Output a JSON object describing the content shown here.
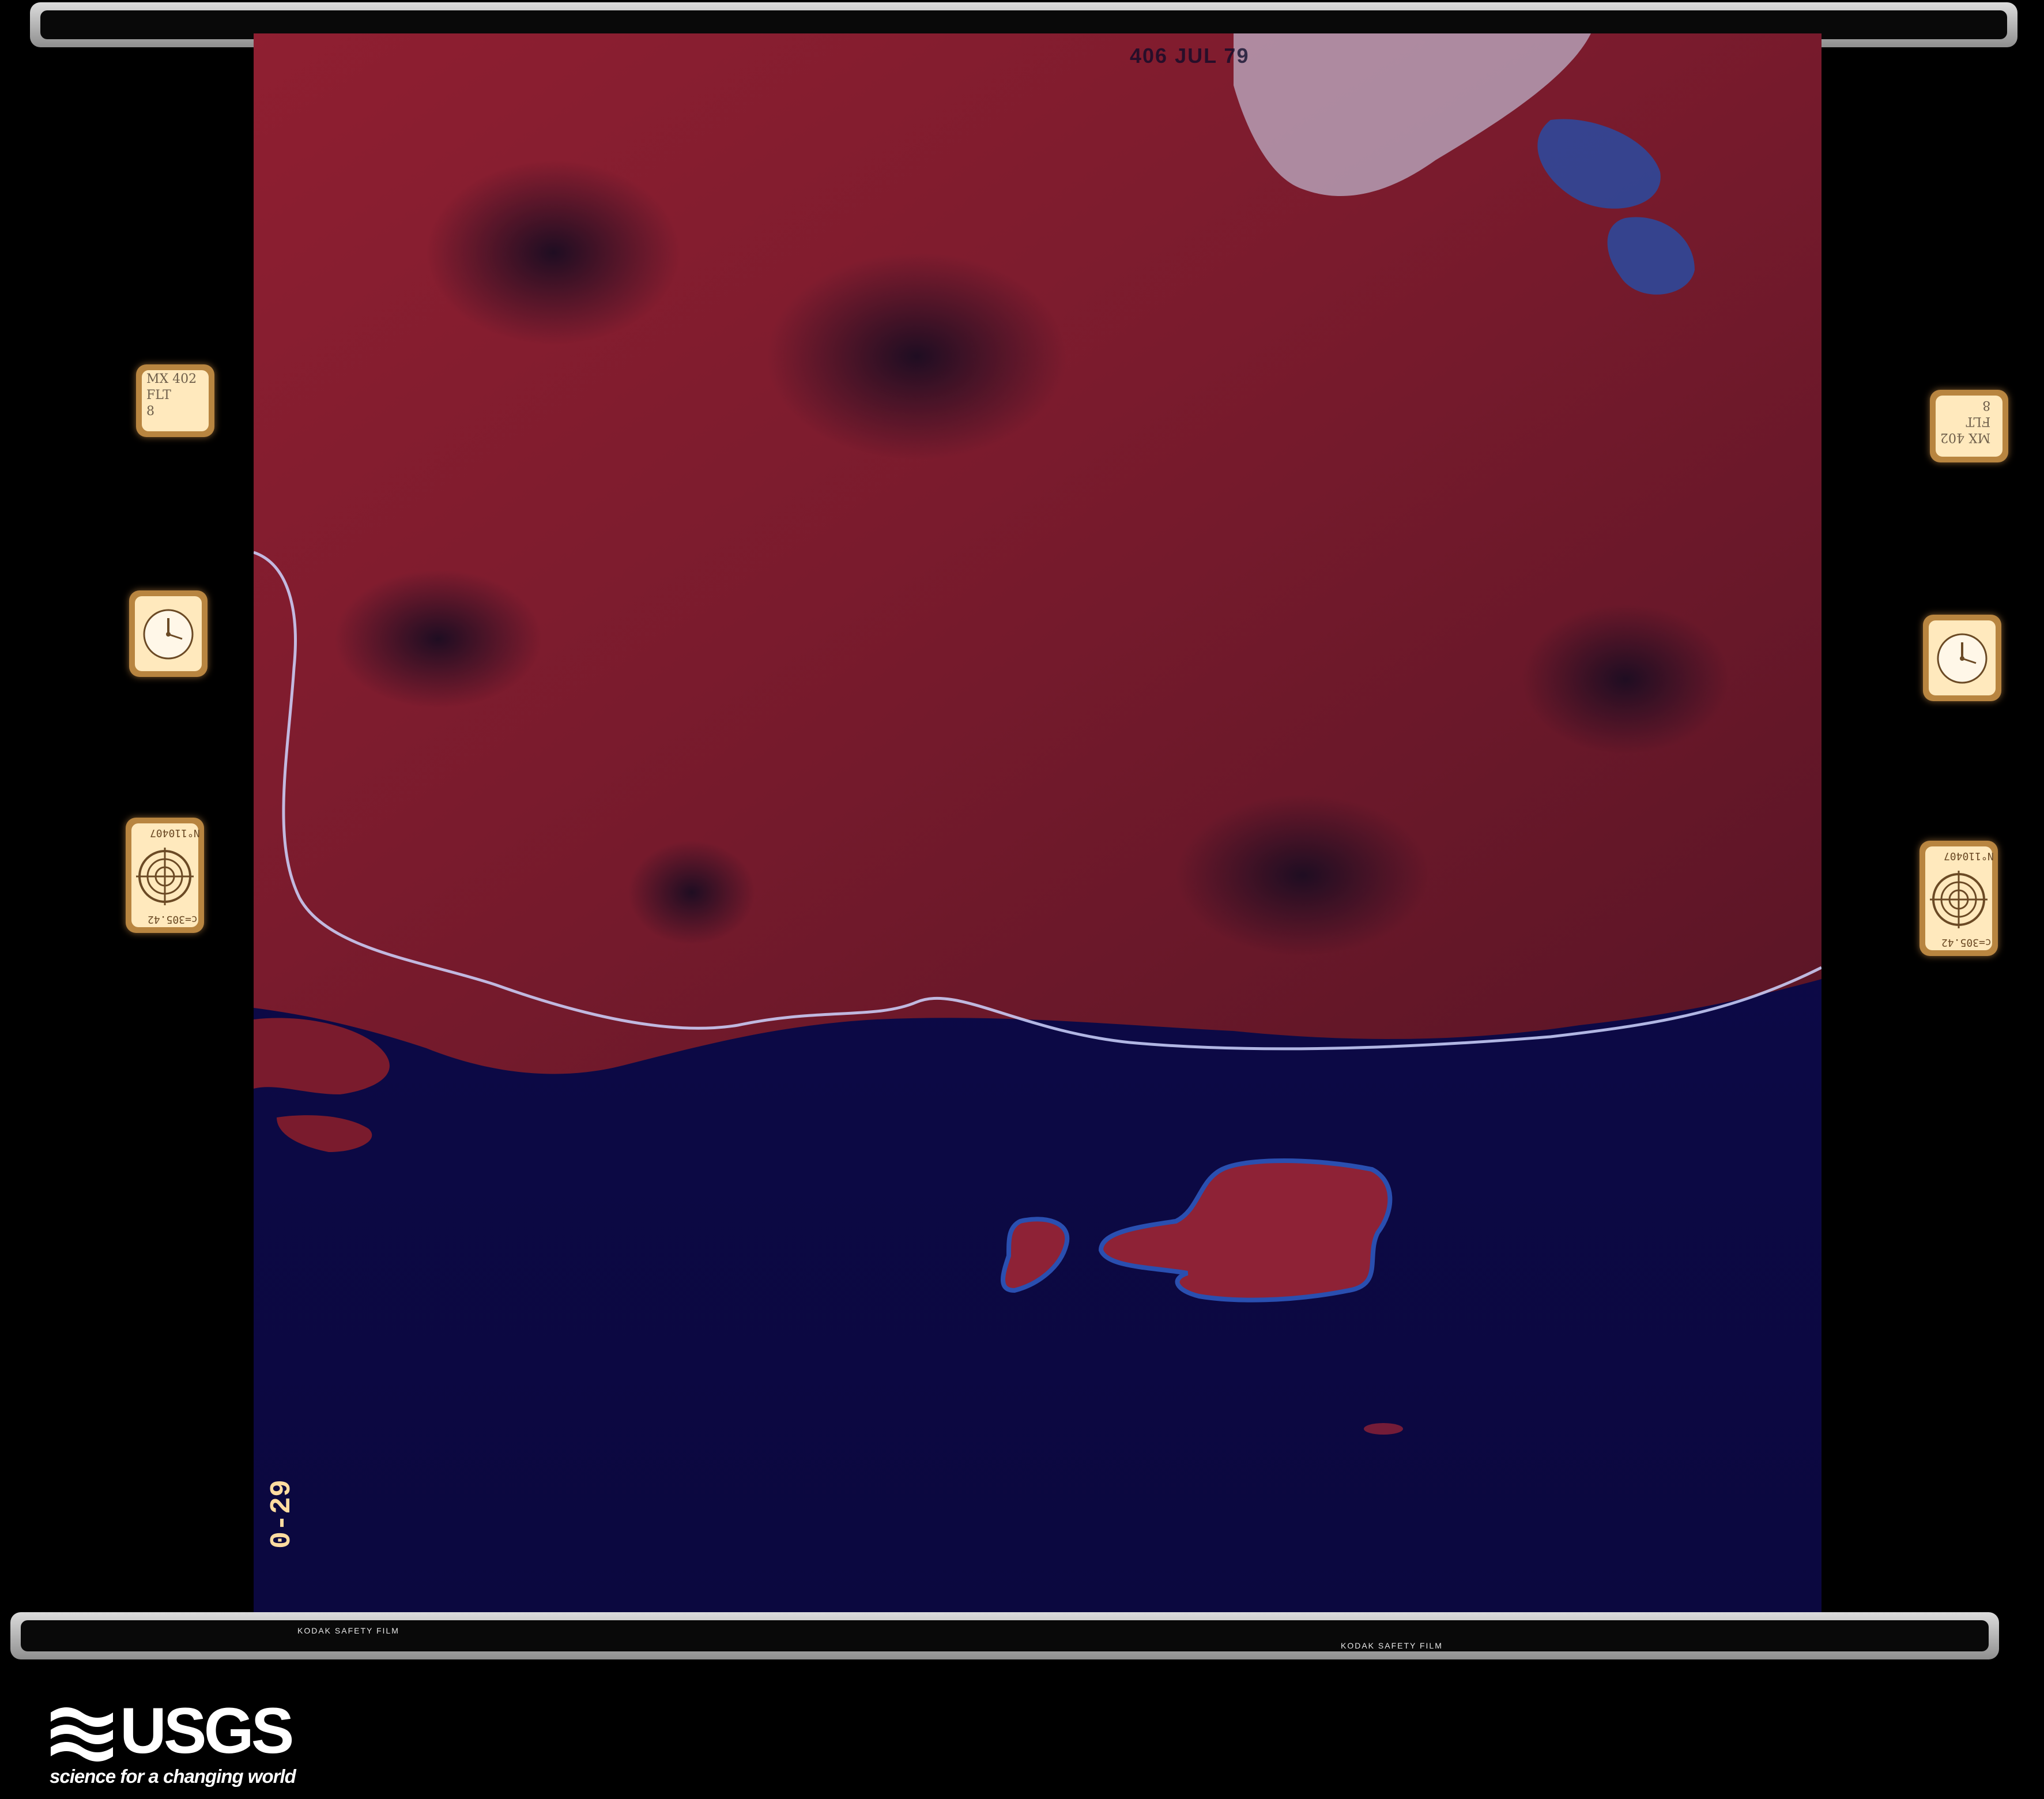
{
  "image": {
    "kind": "aerial color-infrared film frame",
    "colors": {
      "vegetation": "#8b2031",
      "water": "#0d0b4f",
      "snow": "#d9ecff",
      "film_edge": "#cfcfcf",
      "indicator": "#f7d49a"
    }
  },
  "film": {
    "titling": "406 JUL 79",
    "edge_marking_left": "KODAK SAFETY FILM",
    "edge_marking_right": "KODAK SAFETY FILM",
    "frame_number": "0-29"
  },
  "indicators": {
    "left_label": "MX 402\nFLT\n8",
    "right_label": "MX 402\nFLT\n8",
    "left_serial": "N°110407",
    "left_calibration": "c=305.42",
    "right_serial": "N°110407",
    "right_calibration": "c=305.42"
  },
  "logo": {
    "wordmark": "USGS",
    "tagline": "science for a changing world"
  }
}
